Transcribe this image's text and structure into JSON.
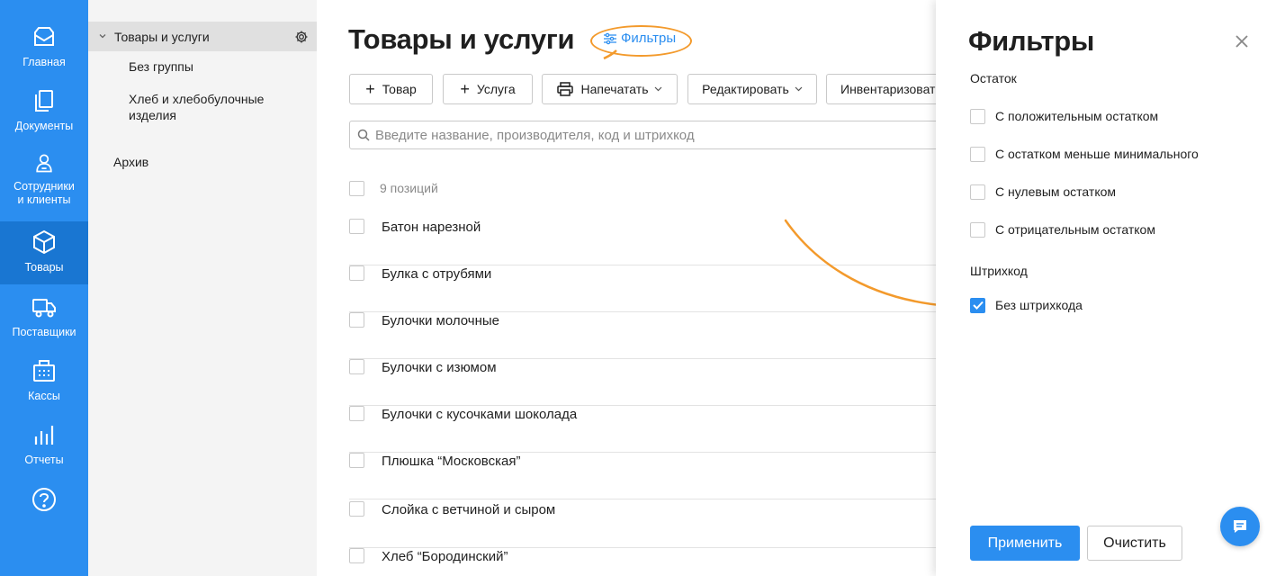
{
  "nav": {
    "items": [
      {
        "label": "Главная",
        "icon": "mail-icon"
      },
      {
        "label": "Документы",
        "icon": "documents-icon"
      },
      {
        "label": "Сотрудники и клиенты",
        "line1": "Сотрудники",
        "line2": "и клиенты",
        "icon": "user-icon"
      },
      {
        "label": "Товары",
        "icon": "box-icon",
        "active": true
      },
      {
        "label": "Поставщики",
        "icon": "truck-icon"
      },
      {
        "label": "Кассы",
        "icon": "register-icon"
      },
      {
        "label": "Отчеты",
        "icon": "bar-chart-icon"
      }
    ],
    "help_icon": "help-icon"
  },
  "tree": {
    "root": "Товары и услуги",
    "children": [
      "Без группы",
      "Хлеб и хлебобулочные изделия"
    ],
    "child2_line1": "Хлеб и хлебобулочные",
    "child2_line2": "изделия",
    "archive": "Архив"
  },
  "main": {
    "title": "Товары и услуги",
    "filters_link": "Фильтры",
    "toolbar": {
      "add_product": "Товар",
      "add_service": "Услуга",
      "print": "Напечатать",
      "edit": "Редактировать",
      "inventory": "Инвентаризовать"
    },
    "search": {
      "placeholder": "Введите название, производителя, код и штрихкод",
      "value": ""
    },
    "count": "9 позиций",
    "items": [
      "Батон нарезной",
      "Булка с отрубями",
      "Булочки молочные",
      "Булочки с изюмом",
      "Булочки с кусочками шоколада",
      "Плюшка “Московская”",
      "Слойка с ветчиной и сыром",
      "Хлеб “Бородинский”"
    ]
  },
  "drawer": {
    "title": "Фильтры",
    "section_stock": "Остаток",
    "stock_options": [
      {
        "label": "С положительным остатком",
        "checked": false
      },
      {
        "label": "С остатком меньше минимального",
        "checked": false
      },
      {
        "label": "С нулевым остатком",
        "checked": false
      },
      {
        "label": "С отрицательным остатком",
        "checked": false
      }
    ],
    "section_barcode": "Штрихкод",
    "barcode_options": [
      {
        "label": "Без штрихкода",
        "checked": true
      }
    ],
    "apply": "Применить",
    "clear": "Очистить"
  },
  "colors": {
    "accent": "#2b8ef0",
    "nav_active": "#1976d2",
    "annotation": "#f39a2c"
  }
}
